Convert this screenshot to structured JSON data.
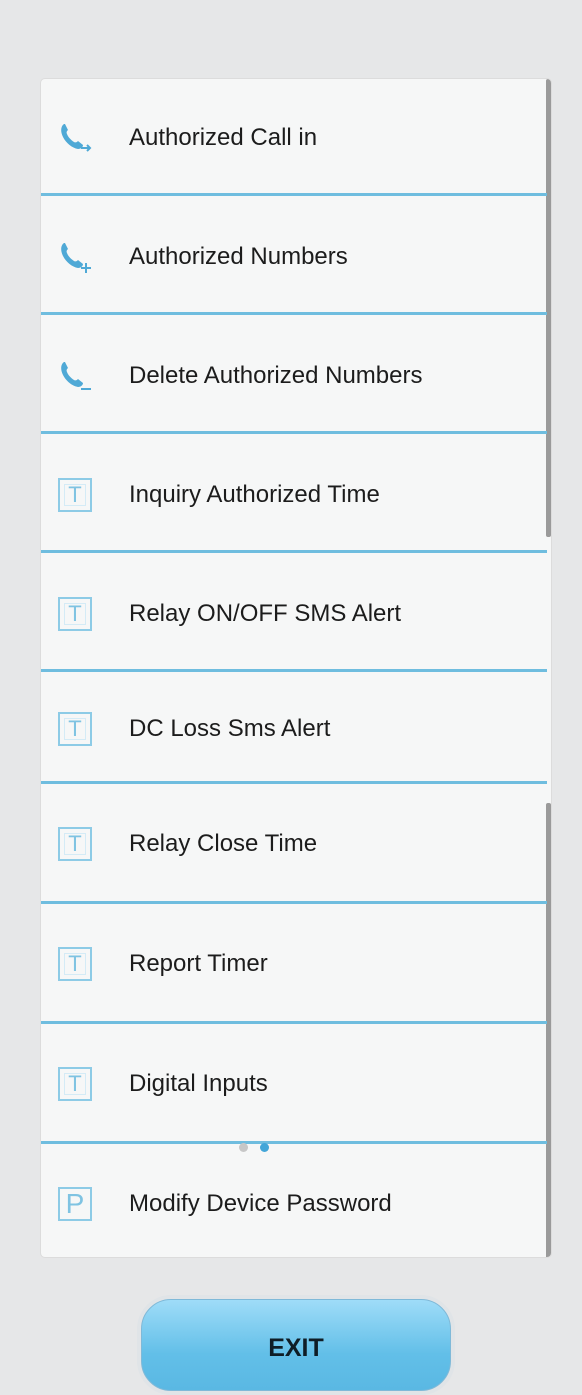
{
  "menu": {
    "items": [
      {
        "label": "Authorized Call in",
        "icon": "phone-arrow-icon"
      },
      {
        "label": "Authorized Numbers",
        "icon": "phone-plus-icon"
      },
      {
        "label": "Delete Authorized Numbers",
        "icon": "phone-minus-icon"
      },
      {
        "label": "Inquiry Authorized Time",
        "icon": "t-box-icon"
      },
      {
        "label": "Relay ON/OFF SMS Alert",
        "icon": "t-box-icon"
      },
      {
        "label": "DC Loss Sms Alert",
        "icon": "t-box-icon"
      },
      {
        "label": "Relay Close Time",
        "icon": "t-box-icon"
      },
      {
        "label": "Report Timer",
        "icon": "t-box-icon"
      },
      {
        "label": "Digital Inputs",
        "icon": "t-box-icon"
      },
      {
        "label": "Modify Device Password",
        "icon": "p-box-icon"
      }
    ],
    "t_glyph": "T",
    "p_glyph": "P"
  },
  "pager": {
    "pages": 2,
    "current": 2
  },
  "footer": {
    "exit_label": "EXIT"
  },
  "colors": {
    "accent": "#6fbddf",
    "icon": "#4fa9d6",
    "background": "#e6e7e8",
    "card": "#f6f7f7"
  }
}
